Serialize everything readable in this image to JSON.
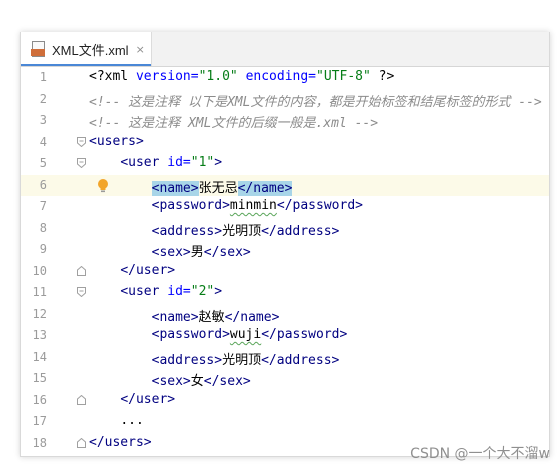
{
  "tab": {
    "filename": "XML文件.xml",
    "close_glyph": "×",
    "icon": "xml-file-icon"
  },
  "lines": {
    "l1": {
      "num": "1",
      "decl": "<?xml",
      "a1": "version=",
      "v1": "\"1.0\"",
      "a2": "encoding=",
      "v2": "\"UTF-8\"",
      "end": "?>"
    },
    "l2": {
      "num": "2",
      "comment": "<!-- 这是注释 以下是XML文件的内容，都是开始标签和结尾标签的形式 -->"
    },
    "l3": {
      "num": "3",
      "comment": "<!-- 这是注释 XML文件的后缀一般是.xml -->"
    },
    "l4": {
      "num": "4",
      "open": "<users",
      "close": ">"
    },
    "l5": {
      "num": "5",
      "open": "<user",
      "attr": "id=",
      "val": "\"1\"",
      "close": ">"
    },
    "l6": {
      "num": "6",
      "tag_open": "<name>",
      "text": "张无忌",
      "tag_close": "</name>"
    },
    "l7": {
      "num": "7",
      "tag_open": "<password>",
      "text": "minmin",
      "tag_close": "</password>"
    },
    "l8": {
      "num": "8",
      "tag_open": "<address>",
      "text": "光明顶",
      "tag_close": "</address>"
    },
    "l9": {
      "num": "9",
      "tag_open": "<sex>",
      "text": "男",
      "tag_close": "</sex>"
    },
    "l10": {
      "num": "10",
      "tag": "</user>"
    },
    "l11": {
      "num": "11",
      "open": "<user",
      "attr": "id=",
      "val": "\"2\"",
      "close": ">"
    },
    "l12": {
      "num": "12",
      "tag_open": "<name>",
      "text": "赵敏",
      "tag_close": "</name>"
    },
    "l13": {
      "num": "13",
      "tag_open": "<password>",
      "text": "wuji",
      "tag_close": "</password>"
    },
    "l14": {
      "num": "14",
      "tag_open": "<address>",
      "text": "光明顶",
      "tag_close": "</address>"
    },
    "l15": {
      "num": "15",
      "tag_open": "<sex>",
      "text": "女",
      "tag_close": "</sex>"
    },
    "l16": {
      "num": "16",
      "tag": "</user>"
    },
    "l17": {
      "num": "17",
      "text": "..."
    },
    "l18": {
      "num": "18",
      "tag": "</users>"
    }
  },
  "watermark": "CSDN @一个大不溜w",
  "colors": {
    "tag": "#000080",
    "attr": "#0000ff",
    "string": "#067d17",
    "comment": "#8c8c8c",
    "tag_highlight": "#a8d5e8",
    "caret_line": "#fcfae8",
    "tab_underline": "#4a87d6"
  }
}
